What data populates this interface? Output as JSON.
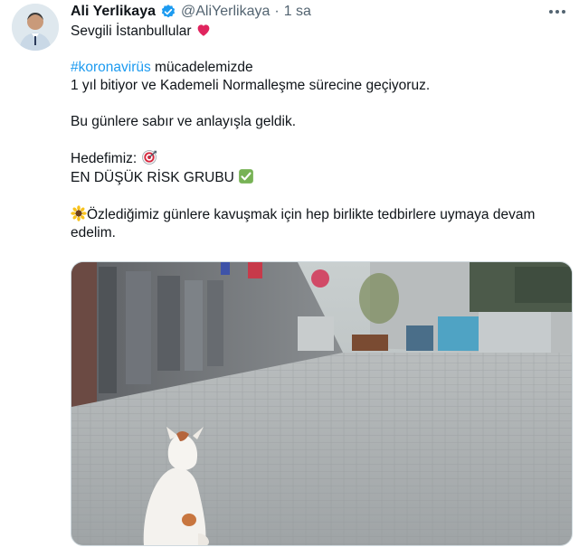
{
  "author": {
    "name": "Ali Yerlikaya",
    "handle": "@AliYerlikaya",
    "separator": "·",
    "time": "1 sa"
  },
  "tweet": {
    "line1_text": "Sevgili İstanbullular",
    "line1_emoji": "red-heart",
    "hashtag": "#koronavirüs",
    "line2_rest": " mücadelemizde",
    "line3": "1 yıl bitiyor ve Kademeli Normalleşme sürecine geçiyoruz.",
    "line4": "Bu günlere sabır ve anlayışla geldik.",
    "line5_text": "Hedefimiz:",
    "line5_emoji": "target-dart",
    "line6_text": "EN DÜŞÜK RİSK GRUBU",
    "line6_emoji": "check-mark-button",
    "line7_emoji": "sunflower",
    "line7_text": "Özlediğimiz günlere kavuşmak için hep birlikte tedbirlere uymaya devam edelim."
  },
  "media": {
    "description_icon": "street-cat-photo"
  },
  "colors": {
    "link": "#1d9bf0",
    "verified": "#1d9bf0",
    "secondary_text": "#536471",
    "heart": "#e0245e"
  },
  "icons": [
    "verified-badge-icon",
    "more-options-icon",
    "heart-emoji-icon",
    "target-emoji-icon",
    "check-emoji-icon",
    "sunflower-emoji-icon"
  ]
}
